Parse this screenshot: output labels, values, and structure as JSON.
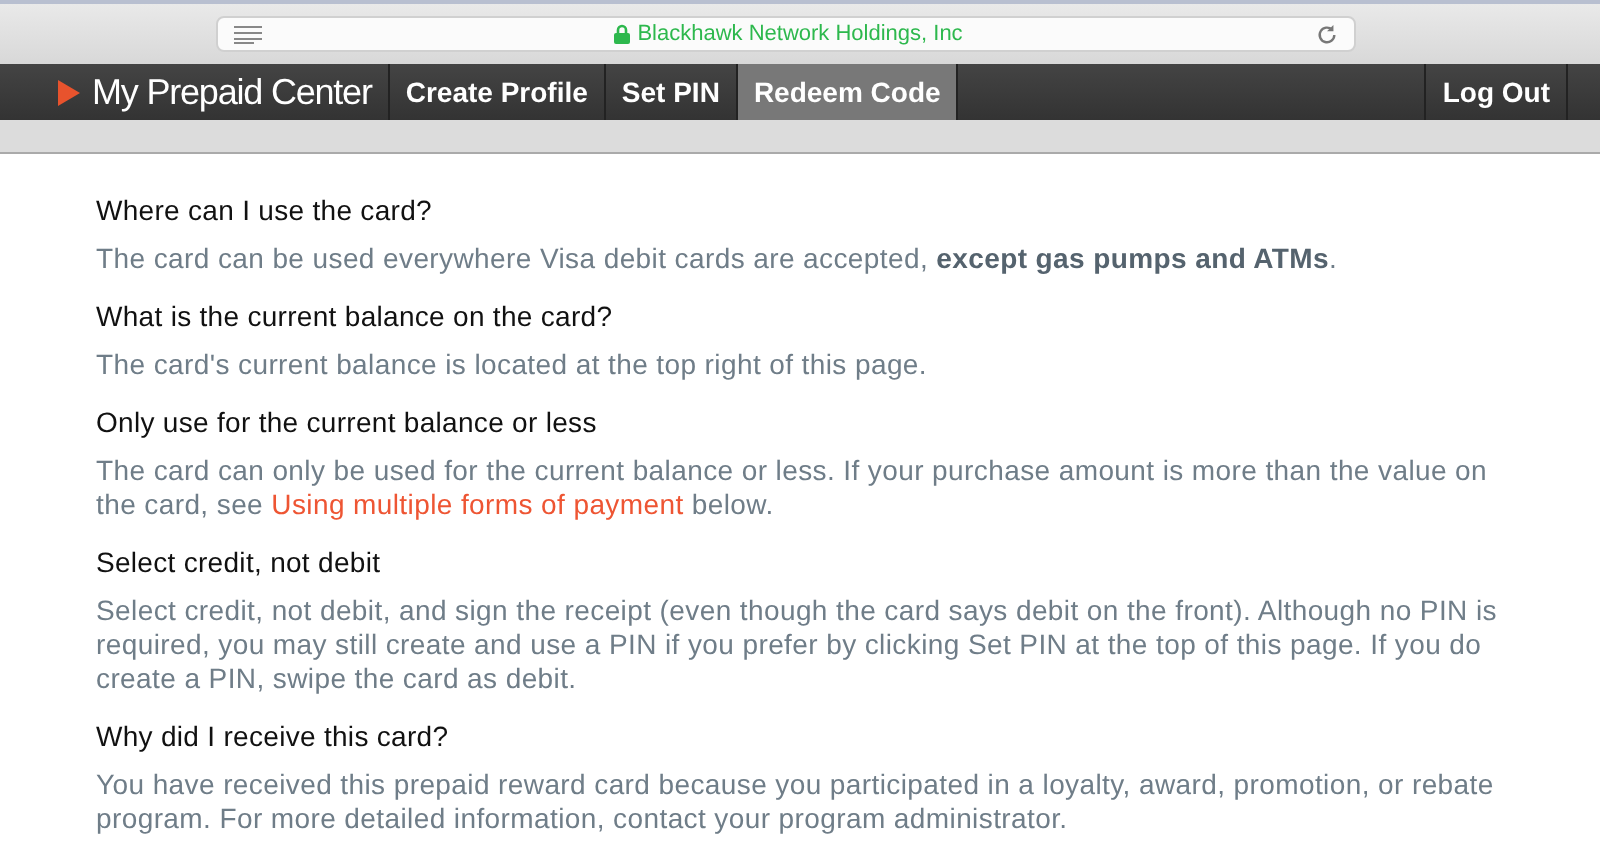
{
  "browser": {
    "address": "Blackhawk Network Holdings, Inc",
    "secure": true
  },
  "nav": {
    "logo": "My Prepaid Center",
    "items": [
      {
        "label": "Create Profile",
        "selected": false
      },
      {
        "label": "Set PIN",
        "selected": false
      },
      {
        "label": "Redeem Code",
        "selected": true
      }
    ],
    "logout": "Log Out"
  },
  "faq": [
    {
      "question": "Where can I use the card?",
      "answer": [
        {
          "kind": "text",
          "text": "The card can be used everywhere Visa debit cards are accepted, **except gas pumps and ATMs**."
        }
      ]
    },
    {
      "question": "What is the current balance on the card?",
      "answer": [
        {
          "kind": "text",
          "text": "The card's current balance is located at the top right of this page."
        }
      ]
    },
    {
      "question": "Only use for the current balance or less",
      "answer": [
        {
          "kind": "text",
          "text": "The card can only be used for the current balance or less. If your purchase amount is more than the value on the card, see "
        },
        {
          "kind": "link",
          "text": "Using multiple forms of payment"
        },
        {
          "kind": "text",
          "text": " below."
        }
      ]
    },
    {
      "question": "Select credit, not debit",
      "answer": [
        {
          "kind": "text",
          "text": "Select credit, not debit, and sign the receipt (even though the card says debit on the front). Although no PIN is required, you may still create and use a PIN if you prefer by clicking Set PIN at the top of this page. If you do create a PIN, swipe the card as debit."
        }
      ]
    },
    {
      "question": "Why did I receive this card?",
      "answer": [
        {
          "kind": "text",
          "text": "You have received this prepaid reward card because you participated in a loyalty, award, promotion, or rebate program. For more detailed information, contact your program administrator."
        }
      ]
    }
  ]
}
